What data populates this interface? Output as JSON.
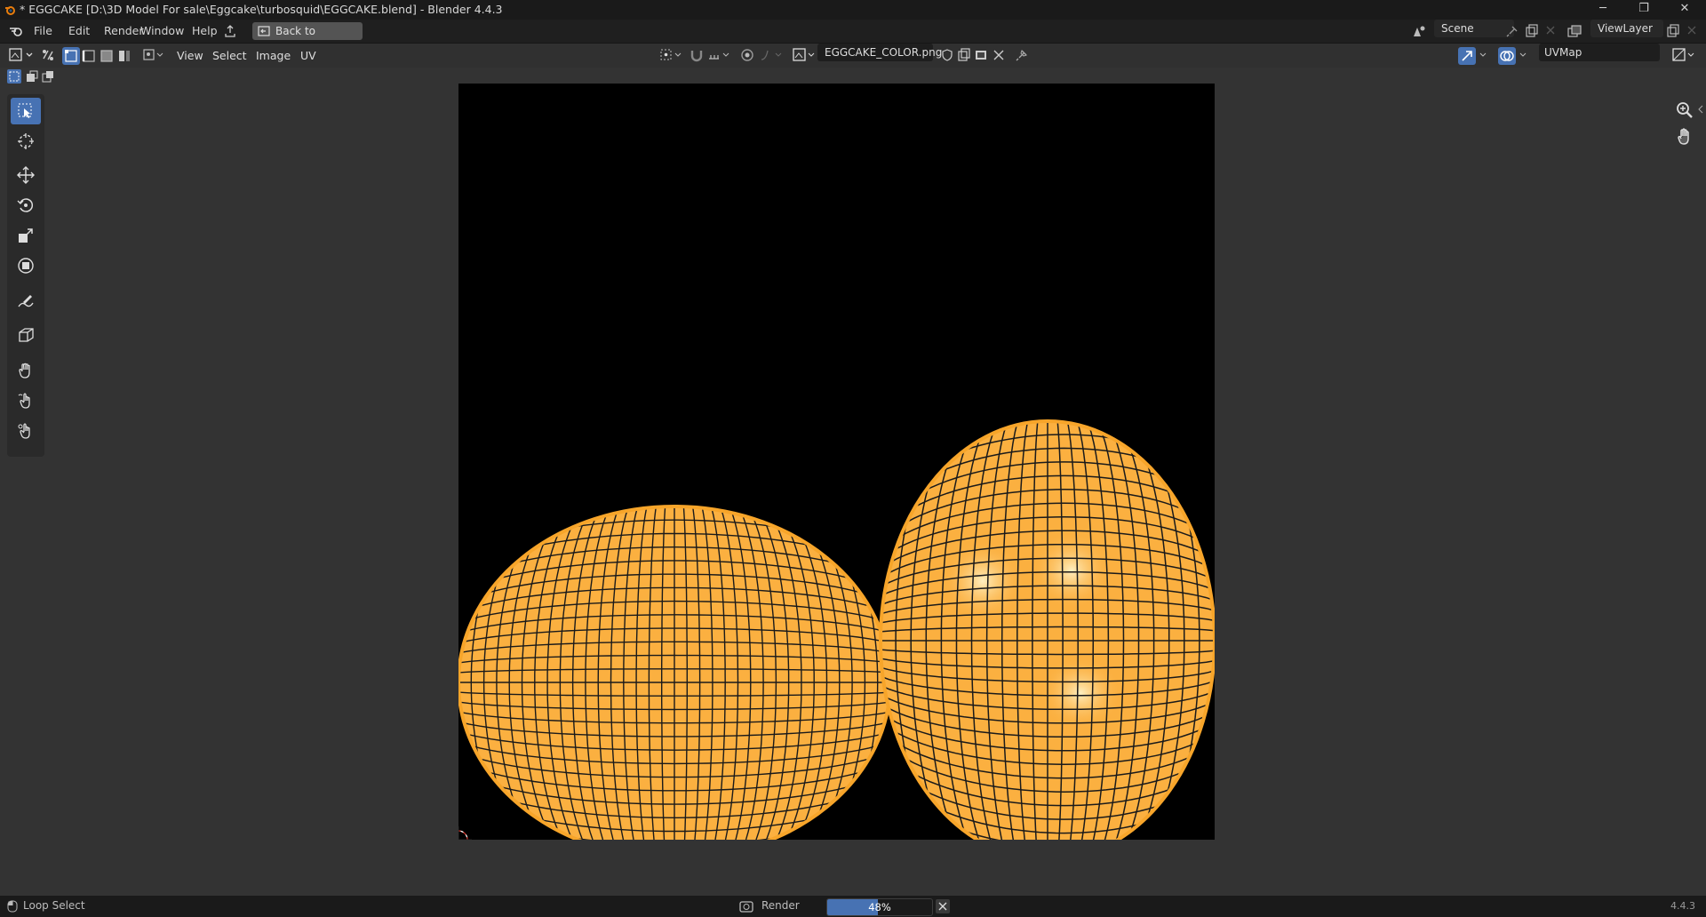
{
  "window": {
    "title": "* EGGCAKE [D:\\3D Model For sale\\Eggcake\\turbosquid\\EGGCAKE.blend] - Blender 4.4.3",
    "minimize_glyph": "─",
    "maximize_glyph": "❐",
    "close_glyph": "✕"
  },
  "menubar": {
    "items": [
      "File",
      "Edit",
      "Render",
      "Window",
      "Help"
    ],
    "back_button": "Back to Previous",
    "scene": "Scene",
    "view_layer": "ViewLayer"
  },
  "image_header": {
    "menus": [
      "View",
      "Select",
      "Image",
      "UV"
    ],
    "image_name": "EGGCAKE_COLOR.png",
    "uv_map": "UVMap"
  },
  "status": {
    "hint": "Loop Select",
    "job_label": "Render",
    "progress_text": "48%",
    "progress_value": 48,
    "version": "4.4.3"
  },
  "colors": {
    "accent": "#4772b3",
    "uv_fill": "#fbb040",
    "uv_edge": "#1a1a1a"
  },
  "icons": {
    "toolbar": [
      "select-box-icon",
      "cursor-icon",
      "move-icon",
      "rotate-icon",
      "scale-icon",
      "transform-icon",
      "annotate-icon",
      "rip-icon",
      "grab-icon",
      "relax-icon",
      "pinch-icon"
    ],
    "gizmo": [
      "zoom-icon",
      "pan-hand-icon"
    ]
  }
}
